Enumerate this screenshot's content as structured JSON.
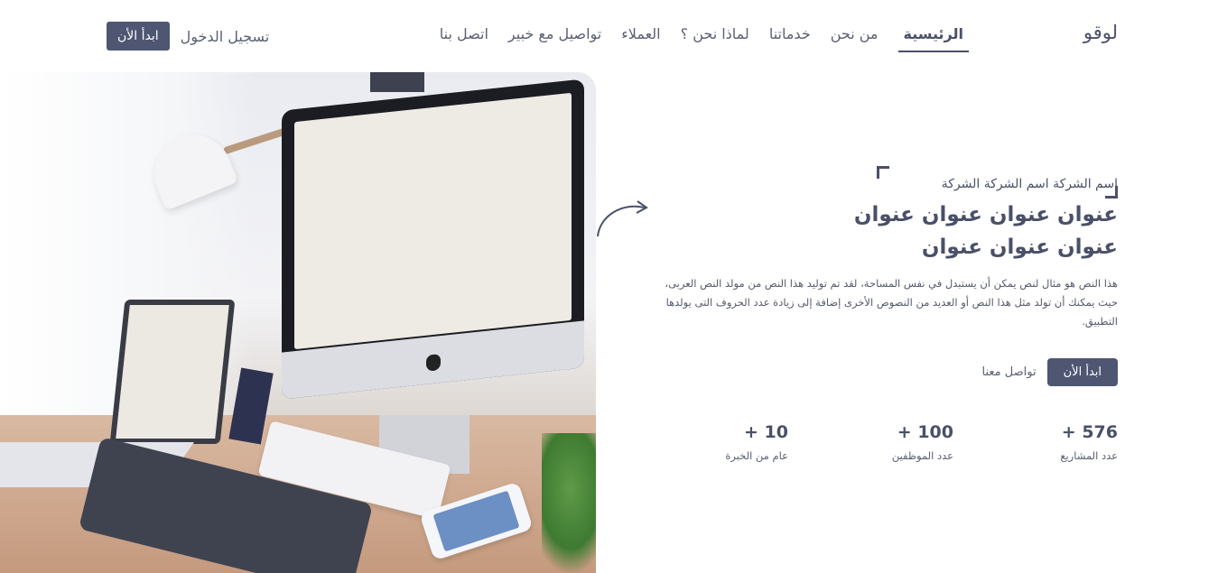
{
  "nav": {
    "logo": "لوقو",
    "items": [
      {
        "label": "الرئيسية",
        "active": true
      },
      {
        "label": "من نحن",
        "active": false
      },
      {
        "label": "خدماتنا",
        "active": false
      },
      {
        "label": "لماذا نحن ؟",
        "active": false
      },
      {
        "label": "العملاء",
        "active": false
      },
      {
        "label": "تواصيل مع خبير",
        "active": false
      },
      {
        "label": "اتصل بنا",
        "active": false
      }
    ],
    "login_label": "تسجيل الدخول",
    "start_label": "ابدأ الأن"
  },
  "hero": {
    "company": "اسم الشركة اسم الشركة الشركة",
    "headline": "عنوان عنوان عنوان عنوان عنوان عنوان عنوان",
    "paragraph": "هذا النص هو مثال لنص يمكن أن يستبدل في نفس المساحة، لقد تم توليد هذا النص من مولد النص العربى، حيث يمكنك أن تولد مثل هذا النص أو العديد من النصوص الأخرى إضافة إلى زيادة عدد الحروف التى يولدها التطبيق.",
    "start_label": "ابدأ الأن",
    "contact_label": "تواصل معنا"
  },
  "stats": [
    {
      "value": "576 +",
      "label": "عدد المشاريع"
    },
    {
      "value": "100 +",
      "label": "عدد الموظفين"
    },
    {
      "value": "10 +",
      "label": "عام من الخبرة"
    }
  ],
  "colors": {
    "primary": "#4f5672",
    "text": "#4a5068"
  }
}
